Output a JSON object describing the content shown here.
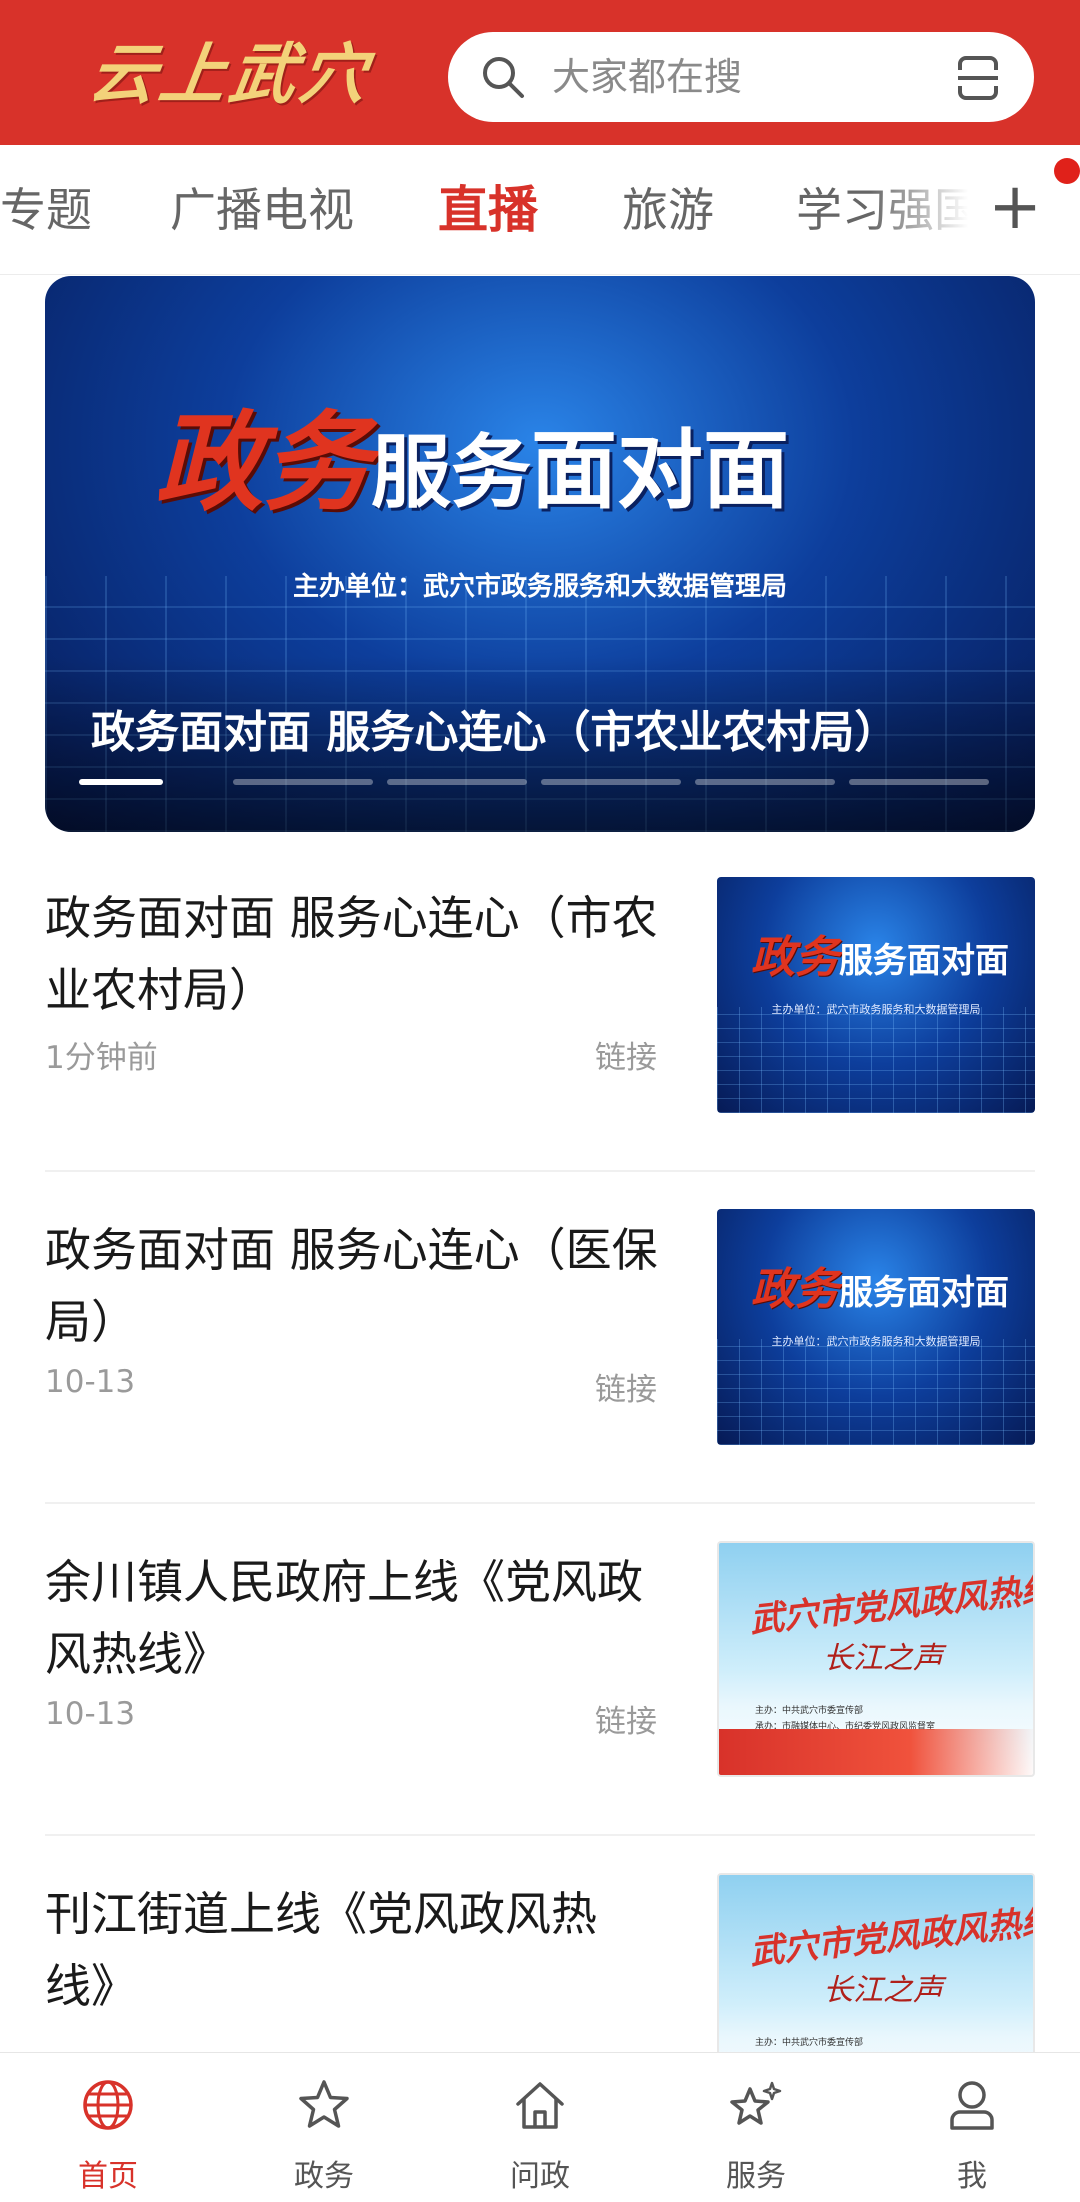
{
  "header": {
    "logo_text": "云上武穴",
    "search_placeholder": "大家都在搜",
    "search_icon": "search-icon",
    "scan_icon": "scan-icon"
  },
  "tabs": [
    {
      "label": "专题",
      "active": false
    },
    {
      "label": "广播电视",
      "active": false
    },
    {
      "label": "直播",
      "active": true
    },
    {
      "label": "旅游",
      "active": false
    },
    {
      "label": "学习强国",
      "active": false
    }
  ],
  "tabs_add_label": "+",
  "banner": {
    "title_red": "政务",
    "title_white_1": "服务",
    "title_white_2": "面对面",
    "sponsor": "主办单位：武穴市政务服务和大数据管理局",
    "caption": "政务面对面 服务心连心（市农业农村局）",
    "slides_count": 6,
    "active_slide": 1
  },
  "news": [
    {
      "title": "政务面对面 服务心连心（市农业农村局）",
      "time": "1分钟前",
      "link_label": "链接",
      "thumb": "blue"
    },
    {
      "title": "政务面对面 服务心连心（医保局）",
      "time": "10-13",
      "link_label": "链接",
      "thumb": "blue"
    },
    {
      "title": "余川镇人民政府上线《党风政风热线》",
      "time": "10-13",
      "link_label": "链接",
      "thumb": "light"
    },
    {
      "title": "刊江街道上线《党风政风热线》",
      "time": "",
      "link_label": "",
      "thumb": "light"
    }
  ],
  "thumb_blue": {
    "title_red": "政务",
    "title_white": "服务面对面",
    "sub": "主办单位：武穴市政务服务和大数据管理局"
  },
  "thumb_light": {
    "title": "武穴市党风政风热线",
    "subtitle": "长江之声",
    "line1": "主办：中共武穴市委宣传部",
    "line2": "承办：市融媒体中心、市纪委党风政风监督室"
  },
  "bottom_nav": [
    {
      "label": "首页",
      "icon": "globe-icon",
      "active": true
    },
    {
      "label": "政务",
      "icon": "star-icon",
      "active": false
    },
    {
      "label": "问政",
      "icon": "home-icon",
      "active": false
    },
    {
      "label": "服务",
      "icon": "sparkle-star-icon",
      "active": false
    },
    {
      "label": "我",
      "icon": "user-icon",
      "active": false
    }
  ],
  "colors": {
    "brand_red": "#d8322a",
    "logo_gold": "#f3d27a",
    "notice_dot": "#e0211a"
  }
}
